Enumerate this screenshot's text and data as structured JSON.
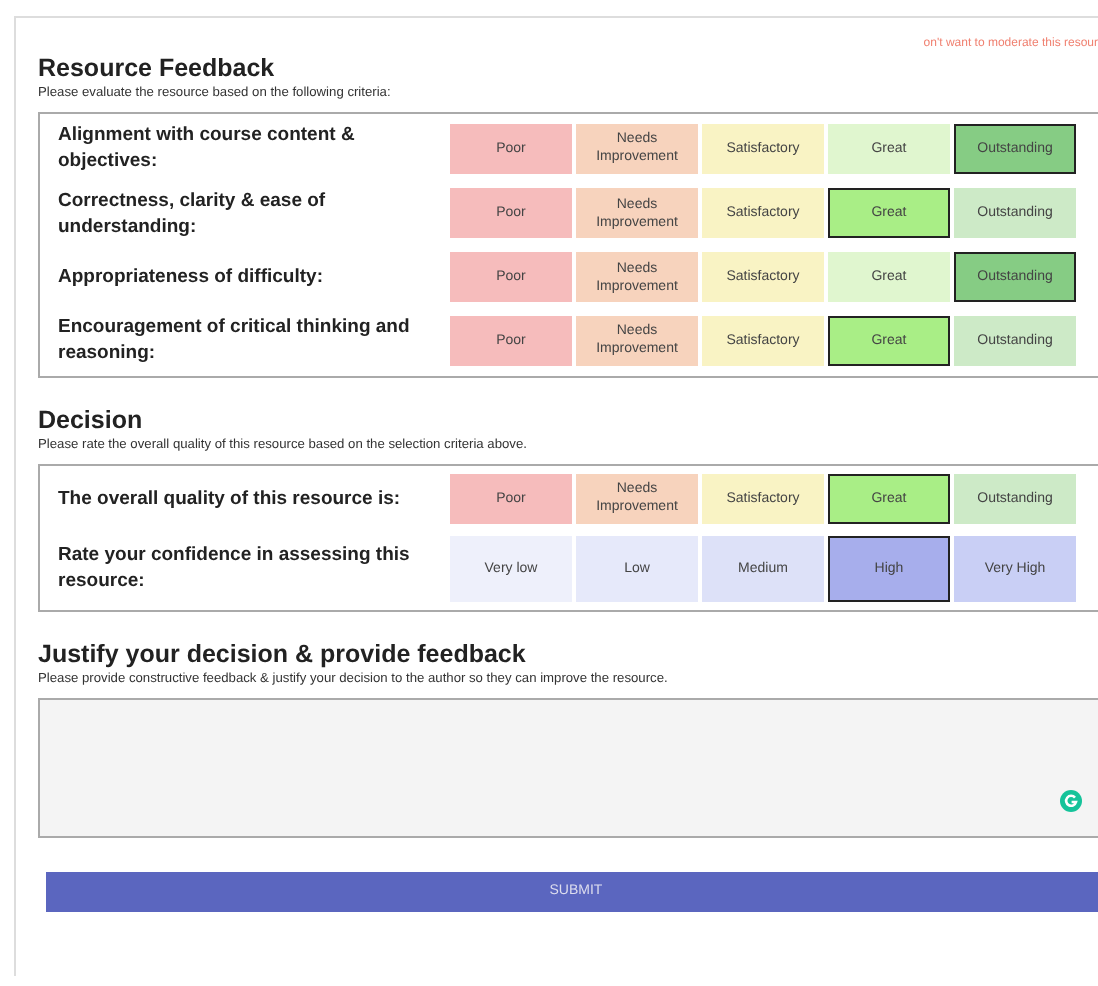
{
  "moderate_link": "on't want to moderate this resour",
  "criteria_section": {
    "title": "Resource Feedback",
    "subtitle": "Please evaluate the resource based on the following criteria:",
    "rows": [
      {
        "label": "Alignment with course content & objectives:",
        "kind": "quality",
        "options": [
          {
            "label": "Poor",
            "selected": false
          },
          {
            "label": "Needs Improvement",
            "selected": false
          },
          {
            "label": "Satisfactory",
            "selected": false
          },
          {
            "label": "Great",
            "selected": false
          },
          {
            "label": "Outstanding",
            "selected": true
          }
        ]
      },
      {
        "label": "Correctness, clarity & ease of understanding:",
        "kind": "quality",
        "options": [
          {
            "label": "Poor",
            "selected": false
          },
          {
            "label": "Needs Improvement",
            "selected": false
          },
          {
            "label": "Satisfactory",
            "selected": false
          },
          {
            "label": "Great",
            "selected": true
          },
          {
            "label": "Outstanding",
            "selected": false
          }
        ]
      },
      {
        "label": "Appropriateness of difficulty:",
        "kind": "quality",
        "options": [
          {
            "label": "Poor",
            "selected": false
          },
          {
            "label": "Needs Improvement",
            "selected": false
          },
          {
            "label": "Satisfactory",
            "selected": false
          },
          {
            "label": "Great",
            "selected": false
          },
          {
            "label": "Outstanding",
            "selected": true
          }
        ]
      },
      {
        "label": "Encouragement of critical thinking and reasoning:",
        "kind": "quality",
        "options": [
          {
            "label": "Poor",
            "selected": false
          },
          {
            "label": "Needs Improvement",
            "selected": false
          },
          {
            "label": "Satisfactory",
            "selected": false
          },
          {
            "label": "Great",
            "selected": true
          },
          {
            "label": "Outstanding",
            "selected": false
          }
        ]
      }
    ]
  },
  "decision_section": {
    "title": "Decision",
    "subtitle": "Please rate the overall quality of this resource based on the selection criteria above.",
    "rows": [
      {
        "label": "The overall quality of this resource is:",
        "kind": "quality",
        "options": [
          {
            "label": "Poor",
            "selected": false
          },
          {
            "label": "Needs Improvement",
            "selected": false
          },
          {
            "label": "Satisfactory",
            "selected": false
          },
          {
            "label": "Great",
            "selected": true
          },
          {
            "label": "Outstanding",
            "selected": false
          }
        ]
      },
      {
        "label": "Rate your confidence in assessing this resource:",
        "kind": "confidence",
        "options": [
          {
            "label": "Very low",
            "selected": false
          },
          {
            "label": "Low",
            "selected": false
          },
          {
            "label": "Medium",
            "selected": false
          },
          {
            "label": "High",
            "selected": true
          },
          {
            "label": "Very High",
            "selected": false
          }
        ]
      }
    ]
  },
  "feedback_section": {
    "title": "Justify your decision & provide feedback",
    "subtitle": "Please provide constructive feedback & justify your decision to the author so they can improve the resource."
  },
  "submit": "SUBMIT"
}
